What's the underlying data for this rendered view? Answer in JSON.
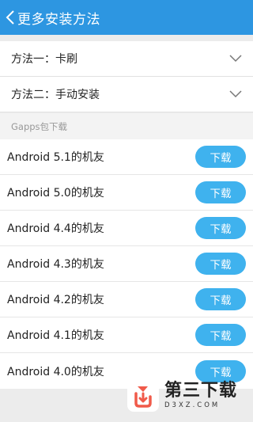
{
  "header": {
    "title": "更多安装方法",
    "back_icon": "chevron-left-icon"
  },
  "methods": [
    {
      "label": "方法一：卡刷",
      "icon": "chevron-down-icon"
    },
    {
      "label": "方法二：手动安装",
      "icon": "chevron-down-icon"
    }
  ],
  "section": {
    "label": "Gapps包下载"
  },
  "downloads": [
    {
      "label": "Android 5.1的机友",
      "button": "下载"
    },
    {
      "label": "Android 5.0的机友",
      "button": "下载"
    },
    {
      "label": "Android 4.4的机友",
      "button": "下载"
    },
    {
      "label": "Android 4.3的机友",
      "button": "下载"
    },
    {
      "label": "Android 4.2的机友",
      "button": "下载"
    },
    {
      "label": "Android 4.1的机友",
      "button": "下载"
    },
    {
      "label": "Android 4.0的机友",
      "button": "下载"
    }
  ],
  "watermark": {
    "name": "第三下载",
    "domain": "D3XZ.COM",
    "icon": "download-logo-icon"
  },
  "colors": {
    "header": "#2d96e1",
    "button": "#3fb2ee",
    "background": "#ececec"
  }
}
